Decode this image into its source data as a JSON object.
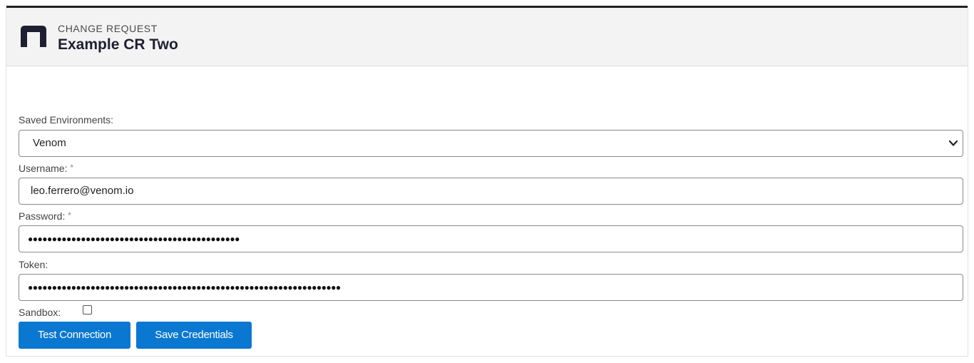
{
  "header": {
    "kicker": "CHANGE REQUEST",
    "title": "Example CR Two"
  },
  "form": {
    "environment": {
      "label": "Saved Environments:",
      "selected": "Venom"
    },
    "username": {
      "label": "Username:",
      "required_mark": "*",
      "value": "leo.ferrero@venom.io"
    },
    "password": {
      "label": "Password:",
      "required_mark": "*",
      "masked_value": "●●●●●●●●●●●●●●●●●●●●●●●●●●●●●●●●●●●●●●●●●●●●"
    },
    "token": {
      "label": "Token:",
      "masked_value": "●●●●●●●●●●●●●●●●●●●●●●●●●●●●●●●●●●●●●●●●●●●●●●●●●●●●●●●●●●●●●●●●●"
    },
    "sandbox": {
      "label": "Sandbox:",
      "checked": false
    }
  },
  "actions": {
    "test_label": "Test Connection",
    "save_label": "Save Credentials"
  },
  "colors": {
    "accent": "#0a78d1",
    "brand_dark": "#1f1f33",
    "header_bg": "#f3f3f3"
  }
}
